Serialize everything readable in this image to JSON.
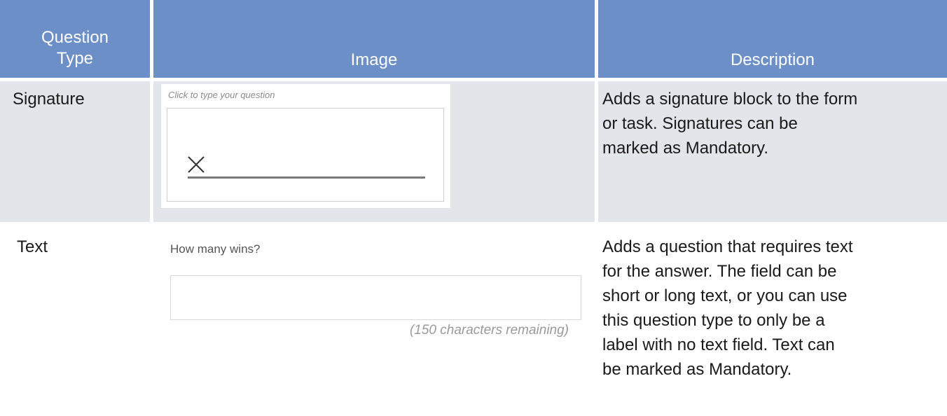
{
  "header": {
    "type_line1": "Question",
    "type_line2": "Type",
    "image": "Image",
    "description": "Description"
  },
  "rows": [
    {
      "type": "Signature",
      "image": {
        "question_placeholder": "Click to type your question",
        "mark_icon": "close-x-icon"
      },
      "description_lines": [
        "Adds a signature block to the form",
        "or task. Signatures can be",
        "marked as Mandatory."
      ]
    },
    {
      "type": "Text",
      "image": {
        "question": "How many wins?",
        "remaining": "(150 characters remaining)"
      },
      "description_lines": [
        "Adds a question that requires text",
        "for the answer. The field can be",
        "short or long text, or you can use",
        "this question type to only be a",
        "label with no text field. Text can",
        "be marked as Mandatory."
      ]
    }
  ],
  "colors": {
    "header_bg": "#6d8fc7",
    "row_shade": "#e2e5ea"
  }
}
